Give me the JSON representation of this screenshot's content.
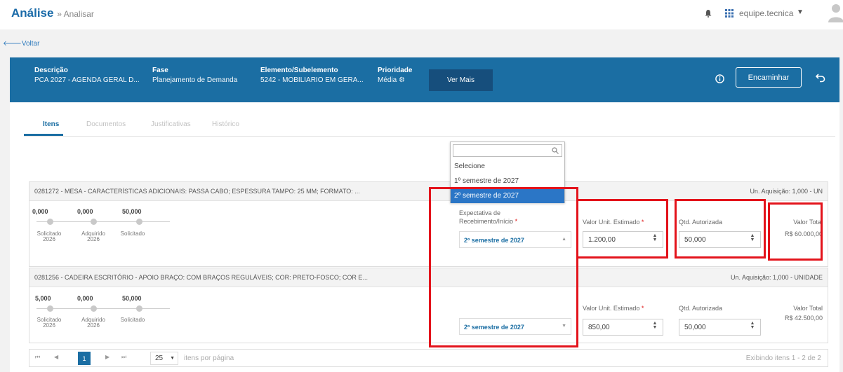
{
  "topbar": {
    "title": "Análise",
    "breadcrumb": "» Analisar",
    "user": "equipe.tecnica"
  },
  "back_label": "Voltar",
  "header": {
    "descricao_label": "Descrição",
    "descricao_value": "PCA 2027 - AGENDA GERAL D...",
    "fase_label": "Fase",
    "fase_value": "Planejamento de Demanda",
    "elemento_label": "Elemento/Subelemento",
    "elemento_value": "5242 - MOBILIARIO EM GERA...",
    "prioridade_label": "Prioridade",
    "prioridade_value": "Média",
    "ver_mais": "Ver Mais",
    "encaminhar": "Encaminhar"
  },
  "tabs": [
    "Itens",
    "Documentos",
    "Justificativas",
    "Histórico"
  ],
  "items": [
    {
      "description": "0281272 - MESA - CARACTERÍSTICAS ADICIONAIS: PASSA CABO; ESPESSURA TAMPO: 25 MM; FORMATO: ...",
      "unit": "Un. Aquisição: 1,000 - UN",
      "progress": [
        {
          "value": "0,000",
          "label": "Solicitado 2026"
        },
        {
          "value": "0,000",
          "label": "Adquirido 2026"
        },
        {
          "value": "50,000",
          "label": "Solicitado"
        }
      ],
      "expectativa_label": "Expectativa de Recebimento/Início",
      "expectativa_value": "2º semestre de 2027",
      "valor_unit_label": "Valor Unit. Estimado",
      "valor_unit": "1.200,00",
      "qtd_label": "Qtd. Autorizada",
      "qtd": "50,000",
      "valor_total_label": "Valor Total",
      "valor_total": "R$ 60.000,00"
    },
    {
      "description": "0281256 - CADEIRA ESCRITÓRIO - APOIO BRAÇO: COM BRAÇOS REGULÁVEIS; COR: PRETO-FOSCO; COR E...",
      "unit": "Un. Aquisição: 1,000 - UNIDADE",
      "progress": [
        {
          "value": "5,000",
          "label": "Solicitado 2026"
        },
        {
          "value": "0,000",
          "label": "Adquirido 2026"
        },
        {
          "value": "50,000",
          "label": "Solicitado"
        }
      ],
      "expectativa_value": "2º semestre de 2027",
      "valor_unit_label": "Valor Unit. Estimado",
      "valor_unit": "850,00",
      "qtd_label": "Qtd. Autorizada",
      "qtd": "50,000",
      "valor_total_label": "Valor Total",
      "valor_total": "R$ 42.500,00"
    }
  ],
  "dropdown": {
    "options": [
      "Selecione",
      "1º semestre de 2027",
      "2º semestre de 2027"
    ],
    "selected": "2º semestre de 2027"
  },
  "pager": {
    "current_page": "1",
    "page_size": "25",
    "per_page_label": "itens por página",
    "summary": "Exibindo itens 1 - 2 de 2"
  },
  "colors": {
    "header_blue": "#1b6ea3",
    "annotation_red": "#e3131b",
    "selected_option": "#2b76c6"
  }
}
